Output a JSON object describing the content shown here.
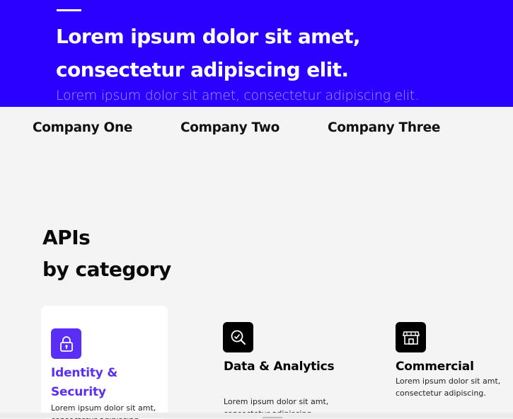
{
  "hero": {
    "title_line1": "Lorem ipsum dolor sit amet,",
    "title_line2": "consectetur adipiscing elit.",
    "subtitle": "Lorem ipsum dolor sit amet, consectetur adipiscing elit."
  },
  "companies": [
    "Company One",
    "Company Two",
    "Company Three"
  ],
  "section": {
    "heading_line1": "APIs",
    "heading_line2": "by category"
  },
  "cards": [
    {
      "title": "Identity & Security",
      "desc": "Lorem ipsum dolor sit amt, consectetur adipiscing.",
      "icon": "lock-icon",
      "active": true
    },
    {
      "title": "Data & Analytics",
      "desc": "Lorem ipsum dolor sit amt, consectetur adipiscing.",
      "icon": "analytics-icon",
      "active": false
    },
    {
      "title": "Commercial",
      "desc": "Lorem ipsum dolor sit amt, consectetur adipiscing.",
      "icon": "storefront-icon",
      "active": false
    }
  ],
  "colors": {
    "hero_bg": "#2b00ff",
    "accent": "#5b2ef5",
    "icon_dark": "#000000"
  }
}
